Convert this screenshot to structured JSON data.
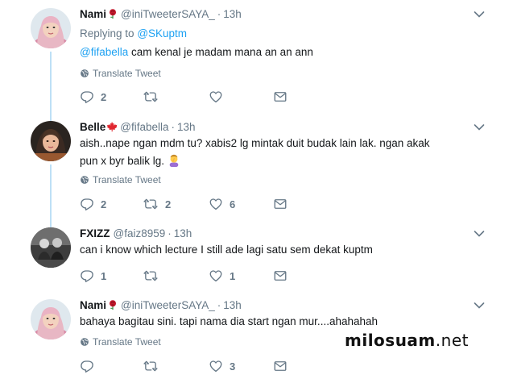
{
  "tweets": [
    {
      "name": "Nami",
      "emoji": "rose",
      "handle": "@iniTweeterSAYA_",
      "time": "13h",
      "replying_label": "Replying to",
      "replying_to": "@SKuptm",
      "mention": "@fifabella",
      "text": " cam kenal je madam mana an an ann",
      "translate": "Translate Tweet",
      "counts": {
        "reply": "2",
        "retweet": "",
        "like": ""
      }
    },
    {
      "name": "Belle",
      "emoji": "maple-leaf",
      "handle": "@fifabella",
      "time": "13h",
      "text": "aish..nape ngan mdm tu? xabis2 lg mintak duit budak lain lak. ngan akak pun x byr balik lg. ",
      "trailing_emoji": "person-facepalming",
      "translate": "Translate Tweet",
      "counts": {
        "reply": "2",
        "retweet": "2",
        "like": "6"
      }
    },
    {
      "name": "FXIZZ",
      "handle": "@faiz8959",
      "time": "13h",
      "text": "can i know which lecture I still ade lagi satu sem dekat kuptm",
      "counts": {
        "reply": "1",
        "retweet": "",
        "like": "1"
      }
    },
    {
      "name": "Nami",
      "emoji": "rose",
      "handle": "@iniTweeterSAYA_",
      "time": "13h",
      "text": "bahaya bagitau sini. tapi nama dia start ngan mur....ahahahah",
      "translate": "Translate Tweet",
      "counts": {
        "reply": "",
        "retweet": "",
        "like": "3"
      }
    }
  ],
  "watermark": {
    "name": "milosuam",
    "tld": ".net"
  },
  "colors": {
    "accent": "#1da1f2",
    "muted": "#657786",
    "thread": "#bde0f6"
  }
}
